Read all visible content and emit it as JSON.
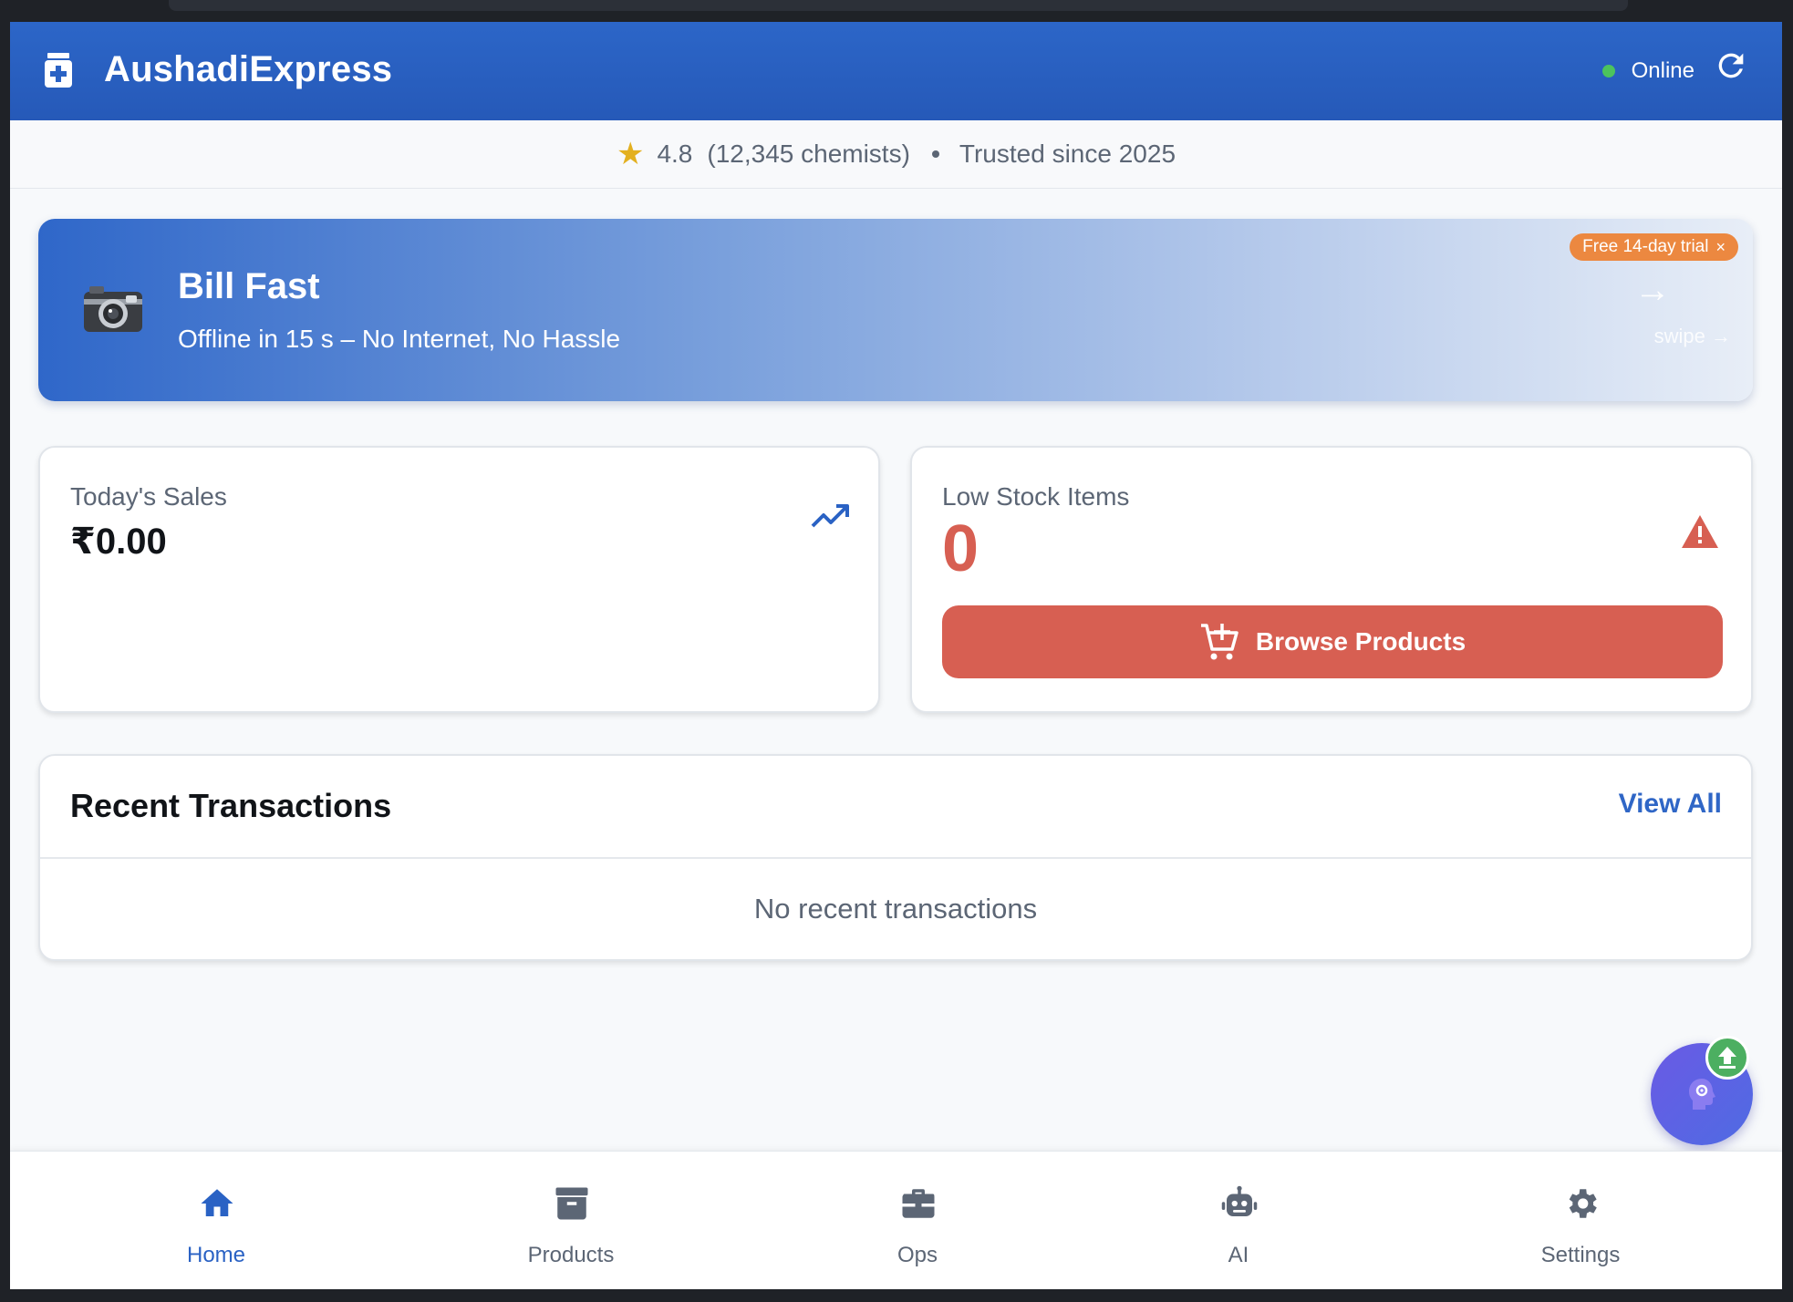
{
  "app": {
    "title": "AushadiExpress",
    "status_text": "Online",
    "status_color": "#4cc35d",
    "brand_color": "#2a62c4",
    "logo_icon": "medical-kit-icon",
    "refresh_icon": "refresh-icon"
  },
  "rating": {
    "star": "★",
    "value": "4.8",
    "count": "(12,345 chemists)",
    "trusted": "Trusted since 2025"
  },
  "promo": {
    "icon": "camera-icon",
    "title": "Bill Fast",
    "subtitle": "Offline in 15 s – No Internet, No Hassle",
    "badge": "Free 14-day trial",
    "badge_close": "×",
    "badge_color": "#ec8840"
  },
  "sales": {
    "label": "Today's Sales",
    "value": "₹0.00",
    "icon": "trending-up-icon"
  },
  "stock": {
    "label": "Low Stock Items",
    "value": "0",
    "icon": "warning-icon",
    "button_label": "Browse Products",
    "button_icon": "cart-plus-icon",
    "accent_color": "#d75f52"
  },
  "transactions": {
    "title": "Recent Transactions",
    "view_all": "View All",
    "empty": "No recent transactions"
  },
  "fab": {
    "icon": "ai-head-icon",
    "badge_icon": "upload-icon"
  },
  "nav": {
    "items": [
      {
        "label": "Home",
        "icon": "home-icon",
        "active": true
      },
      {
        "label": "Products",
        "icon": "archive-box-icon",
        "active": false
      },
      {
        "label": "Ops",
        "icon": "briefcase-icon",
        "active": false
      },
      {
        "label": "AI",
        "icon": "robot-icon",
        "active": false
      },
      {
        "label": "Settings",
        "icon": "gear-icon",
        "active": false
      }
    ]
  }
}
